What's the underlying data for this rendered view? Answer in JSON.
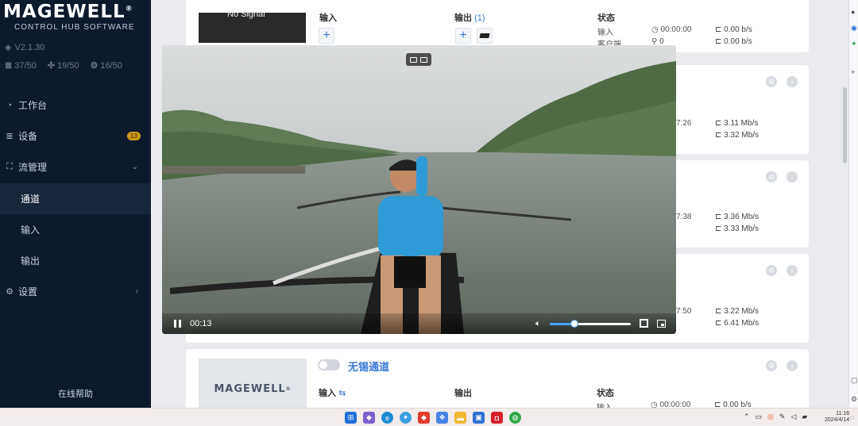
{
  "sidebar": {
    "brand": "MAGEWELL",
    "brand_mark": "®",
    "subtitle": "CONTROL HUB SOFTWARE",
    "version": "V2.1.30",
    "stats": {
      "devices": "37/50",
      "channels": "19/50",
      "streams": "16/50"
    },
    "nav": {
      "dashboard": "工作台",
      "devices": "设备",
      "devices_badge": "13",
      "stream_mgmt": "流管理",
      "channels": "通道",
      "inputs": "输入",
      "outputs": "输出",
      "settings": "设置"
    },
    "help": "在线帮助"
  },
  "cards": {
    "top": {
      "thumb_text": "No Signal",
      "input_label": "输入",
      "output_label": "输出",
      "output_count": "(1)",
      "status_label": "状态",
      "status_input": "输入",
      "status_client": "客户端",
      "input_time": "00:00:00",
      "client_count": "0",
      "rate_in": "0.00 b/s",
      "rate_out": "0.00 b/s"
    },
    "card2": {
      "time": "7:26",
      "rate_in": "3.11 Mb/s",
      "rate_out": "3.32 Mb/s"
    },
    "card3": {
      "time": "7:38",
      "rate_in": "3.36 Mb/s",
      "rate_out": "3.33 Mb/s"
    },
    "card4": {
      "time": "7:50",
      "rate_in": "3.22 Mb/s",
      "rate_out": "6.41 Mb/s"
    },
    "bottom": {
      "brand": "MAGEWELL",
      "brand_mark": "®",
      "name": "无锡通道",
      "input_label": "输入",
      "input_icon": "⇆",
      "output_label": "输出",
      "status_label": "状态",
      "status_input": "输入",
      "input_time": "00:00:00",
      "rate_in": "0.00 b/s"
    }
  },
  "player": {
    "time": "00:13",
    "volume": 0.3
  },
  "taskbar": {
    "time": "11:16",
    "date": "2024/4/14"
  },
  "colors": {
    "sidebar_bg": "#0c1a2b",
    "accent": "#3a78d0",
    "badge": "#c99a1e"
  }
}
